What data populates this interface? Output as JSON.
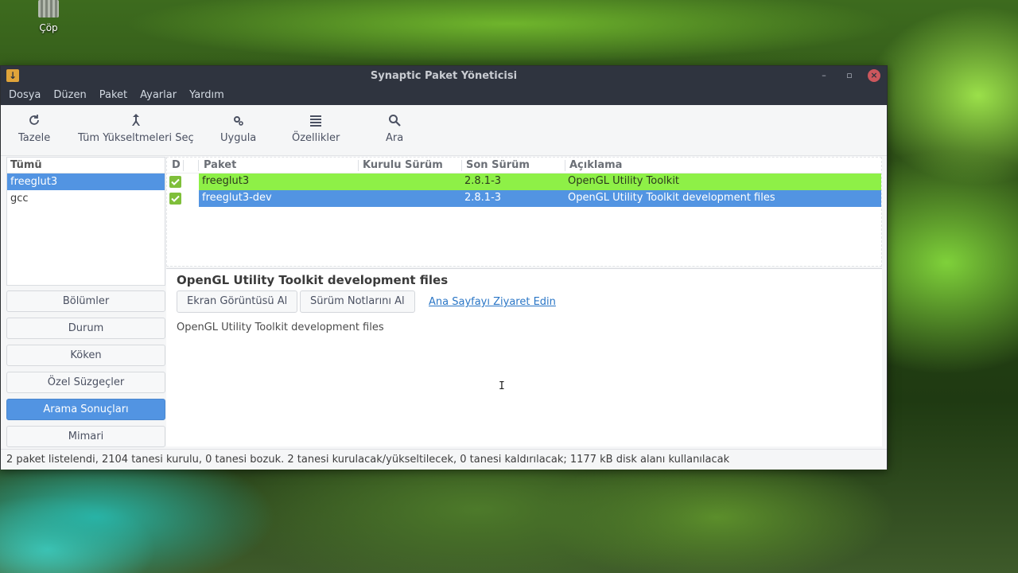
{
  "desktop": {
    "trash_label": "Çöp"
  },
  "window": {
    "title": "Synaptic Paket Yöneticisi"
  },
  "menu": [
    "Dosya",
    "Düzen",
    "Paket",
    "Ayarlar",
    "Yardım"
  ],
  "toolbar": {
    "reload": "Tazele",
    "mark_upgrades": "Tüm Yükseltmeleri Seç",
    "apply": "Uygula",
    "properties": "Özellikler",
    "search": "Ara"
  },
  "filters": {
    "header": "Tümü",
    "items": [
      "freeglut3",
      "gcc"
    ],
    "selected": "freeglut3"
  },
  "side_buttons": {
    "sections": "Bölümler",
    "status": "Durum",
    "origin": "Köken",
    "custom_filters": "Özel Süzgeçler",
    "search_results": "Arama Sonuçları",
    "architecture": "Mimari"
  },
  "packages": {
    "columns": {
      "status": "D",
      "package": "Paket",
      "installed_version": "Kurulu Sürüm",
      "latest_version": "Son Sürüm",
      "description": "Açıklama"
    },
    "rows": [
      {
        "name": "freeglut3",
        "installed": "",
        "latest": "2.8.1-3",
        "description": "OpenGL Utility Toolkit",
        "marked": true
      },
      {
        "name": "freeglut3-dev",
        "installed": "",
        "latest": "2.8.1-3",
        "description": "OpenGL Utility Toolkit development files",
        "marked": true
      }
    ]
  },
  "details": {
    "title": "OpenGL Utility Toolkit development files",
    "screenshot_button": "Ekran Görüntüsü Al",
    "changelog_button": "Sürüm Notlarını Al",
    "homepage_link": "Ana Sayfayı Ziyaret Edin",
    "description": "OpenGL Utility Toolkit development files"
  },
  "statusbar": {
    "text": "2 paket listelendi, 2104 tanesi kurulu, 0 tanesi bozuk. 2 tanesi kurulacak/yükseltilecek, 0 tanesi kaldırılacak; 1177 kB disk alanı kullanılacak"
  },
  "colors": {
    "selection": "#5294e2",
    "marked_install": "#8ef047",
    "titlebar": "#2f343f",
    "close_button": "#cc575d"
  },
  "icons": {
    "reload": "reload-icon",
    "mark_upgrades": "upgrade-icon",
    "apply": "apply-gears-icon",
    "properties": "properties-list-icon",
    "search": "search-icon"
  }
}
